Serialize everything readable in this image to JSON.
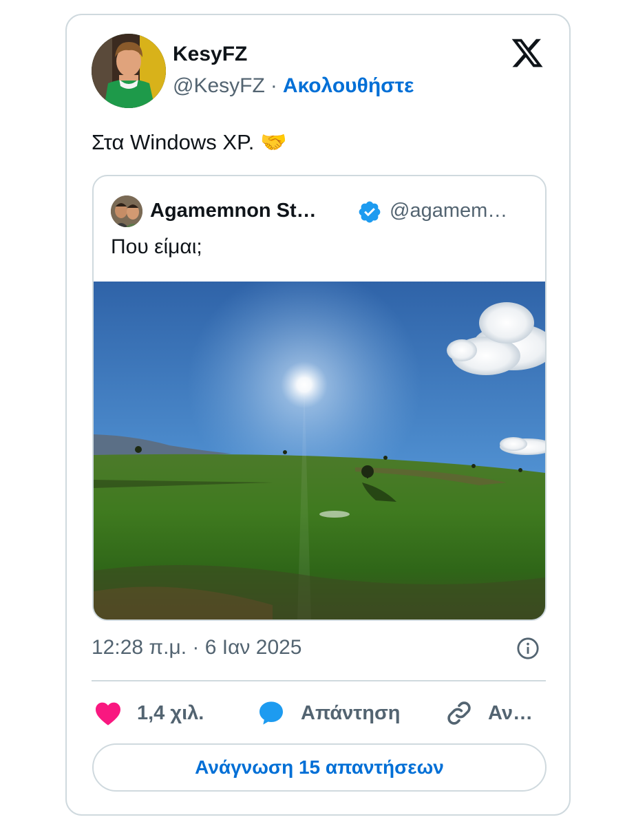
{
  "author": {
    "name": "KesyFZ",
    "handle": "@KesyFZ",
    "separator": "·",
    "follow_label": "Ακολουθήστε"
  },
  "tweet": {
    "text": "Στα Windows XP.",
    "emoji": "🤝",
    "timestamp": "12:28 π.μ. · 6 Ιαν 2025"
  },
  "quoted_tweet": {
    "name": "Agamemnon St…",
    "handle": "@agamem…",
    "verified": true,
    "text": "Που είμαι;"
  },
  "actions": {
    "like_count": "1,4 χιλ.",
    "reply_label": "Απάντηση",
    "copy_label": "Αν…"
  },
  "read_replies_label": "Ανάγνωση 15 απαντήσεων",
  "icons": {
    "logo": "x-logo-icon",
    "verified": "verified-badge-icon",
    "info": "info-icon",
    "like": "heart-icon",
    "reply": "speech-bubble-icon",
    "copy": "link-icon"
  },
  "colors": {
    "link_blue": "#006fd6",
    "verified_blue": "#1d9bf0",
    "heart_pink": "#f91880",
    "muted_text": "#536471",
    "border": "#cfd9de"
  }
}
